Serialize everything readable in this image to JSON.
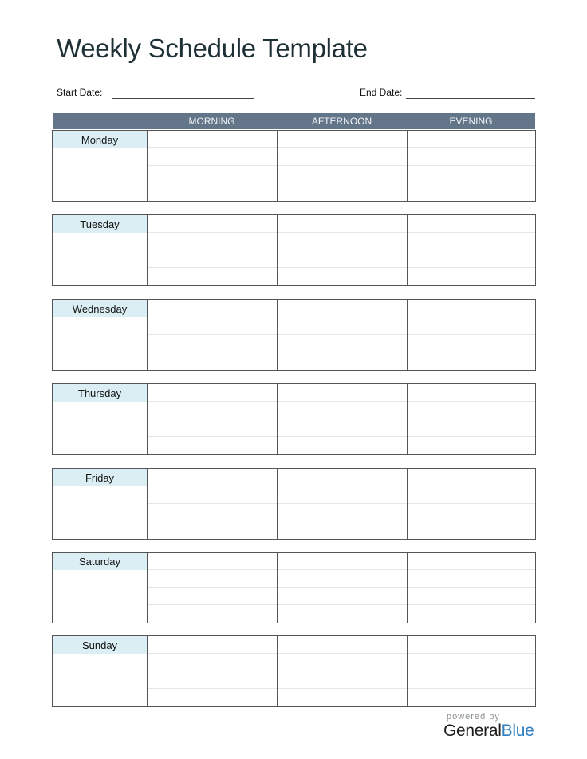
{
  "document": {
    "title": "Weekly Schedule Template",
    "start_date_label": "Start Date:",
    "start_date_value": "",
    "end_date_label": "End Date:",
    "end_date_value": ""
  },
  "table": {
    "columns": [
      "MORNING",
      "AFTERNOON",
      "EVENING"
    ],
    "days": [
      {
        "name": "Monday"
      },
      {
        "name": "Tuesday"
      },
      {
        "name": "Wednesday"
      },
      {
        "name": "Thursday"
      },
      {
        "name": "Friday"
      },
      {
        "name": "Saturday"
      },
      {
        "name": "Sunday"
      }
    ],
    "slots_per_period": 4
  },
  "colors": {
    "header_bg": "#637588",
    "day_label_bg": "#dbeef3",
    "title_color": "#1e2f36",
    "brand_blue": "#2f7fc1"
  },
  "footer": {
    "powered_by": "powered by",
    "brand_general": "General",
    "brand_blue": "Blue"
  }
}
